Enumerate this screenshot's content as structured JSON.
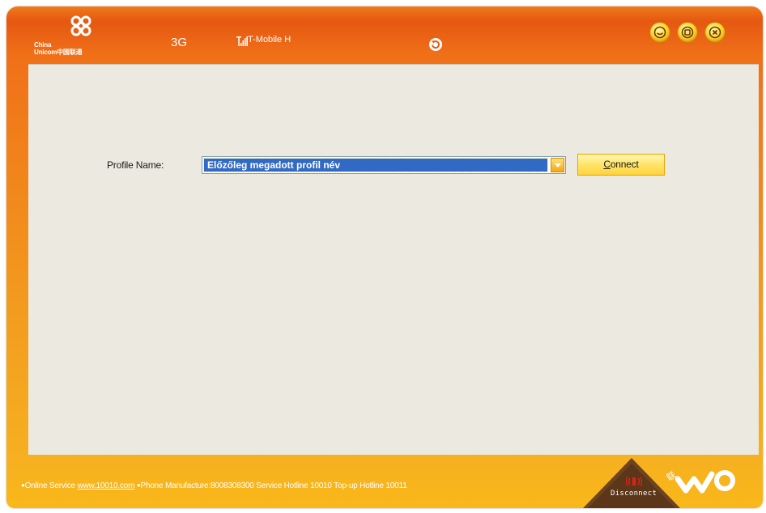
{
  "header": {
    "brand_line1": "China",
    "brand_line2": "Unicom中国联通",
    "network_type": "3G",
    "signal_icon": "signal-bars-icon",
    "carrier": "T-Mobile H",
    "refresh_icon": "refresh-icon",
    "window_controls": [
      "minimize-icon",
      "restore-icon",
      "close-icon"
    ]
  },
  "main": {
    "profile_label": "Profile Name:",
    "profile_selected": "Előzőleg megadott profil név",
    "connect_mnemonic": "C",
    "connect_rest": "onnect"
  },
  "footer": {
    "online_service_label": "Online Service",
    "online_service_link": "www.10010.com",
    "hotlines": "Phone Manufacture:8008308300 Service Hotline 10010 Top-up Hotline 10011",
    "disconnect_label": "Disconnect",
    "disconnect_icon": "phone-signal-icon",
    "brand_logo": "wo-logo"
  },
  "colors": {
    "header_orange": "#e55812",
    "footer_orange": "#f6b020",
    "content_bg": "#ece9e0",
    "selection_blue": "#316ac5",
    "button_yellow": "#ffe264"
  }
}
